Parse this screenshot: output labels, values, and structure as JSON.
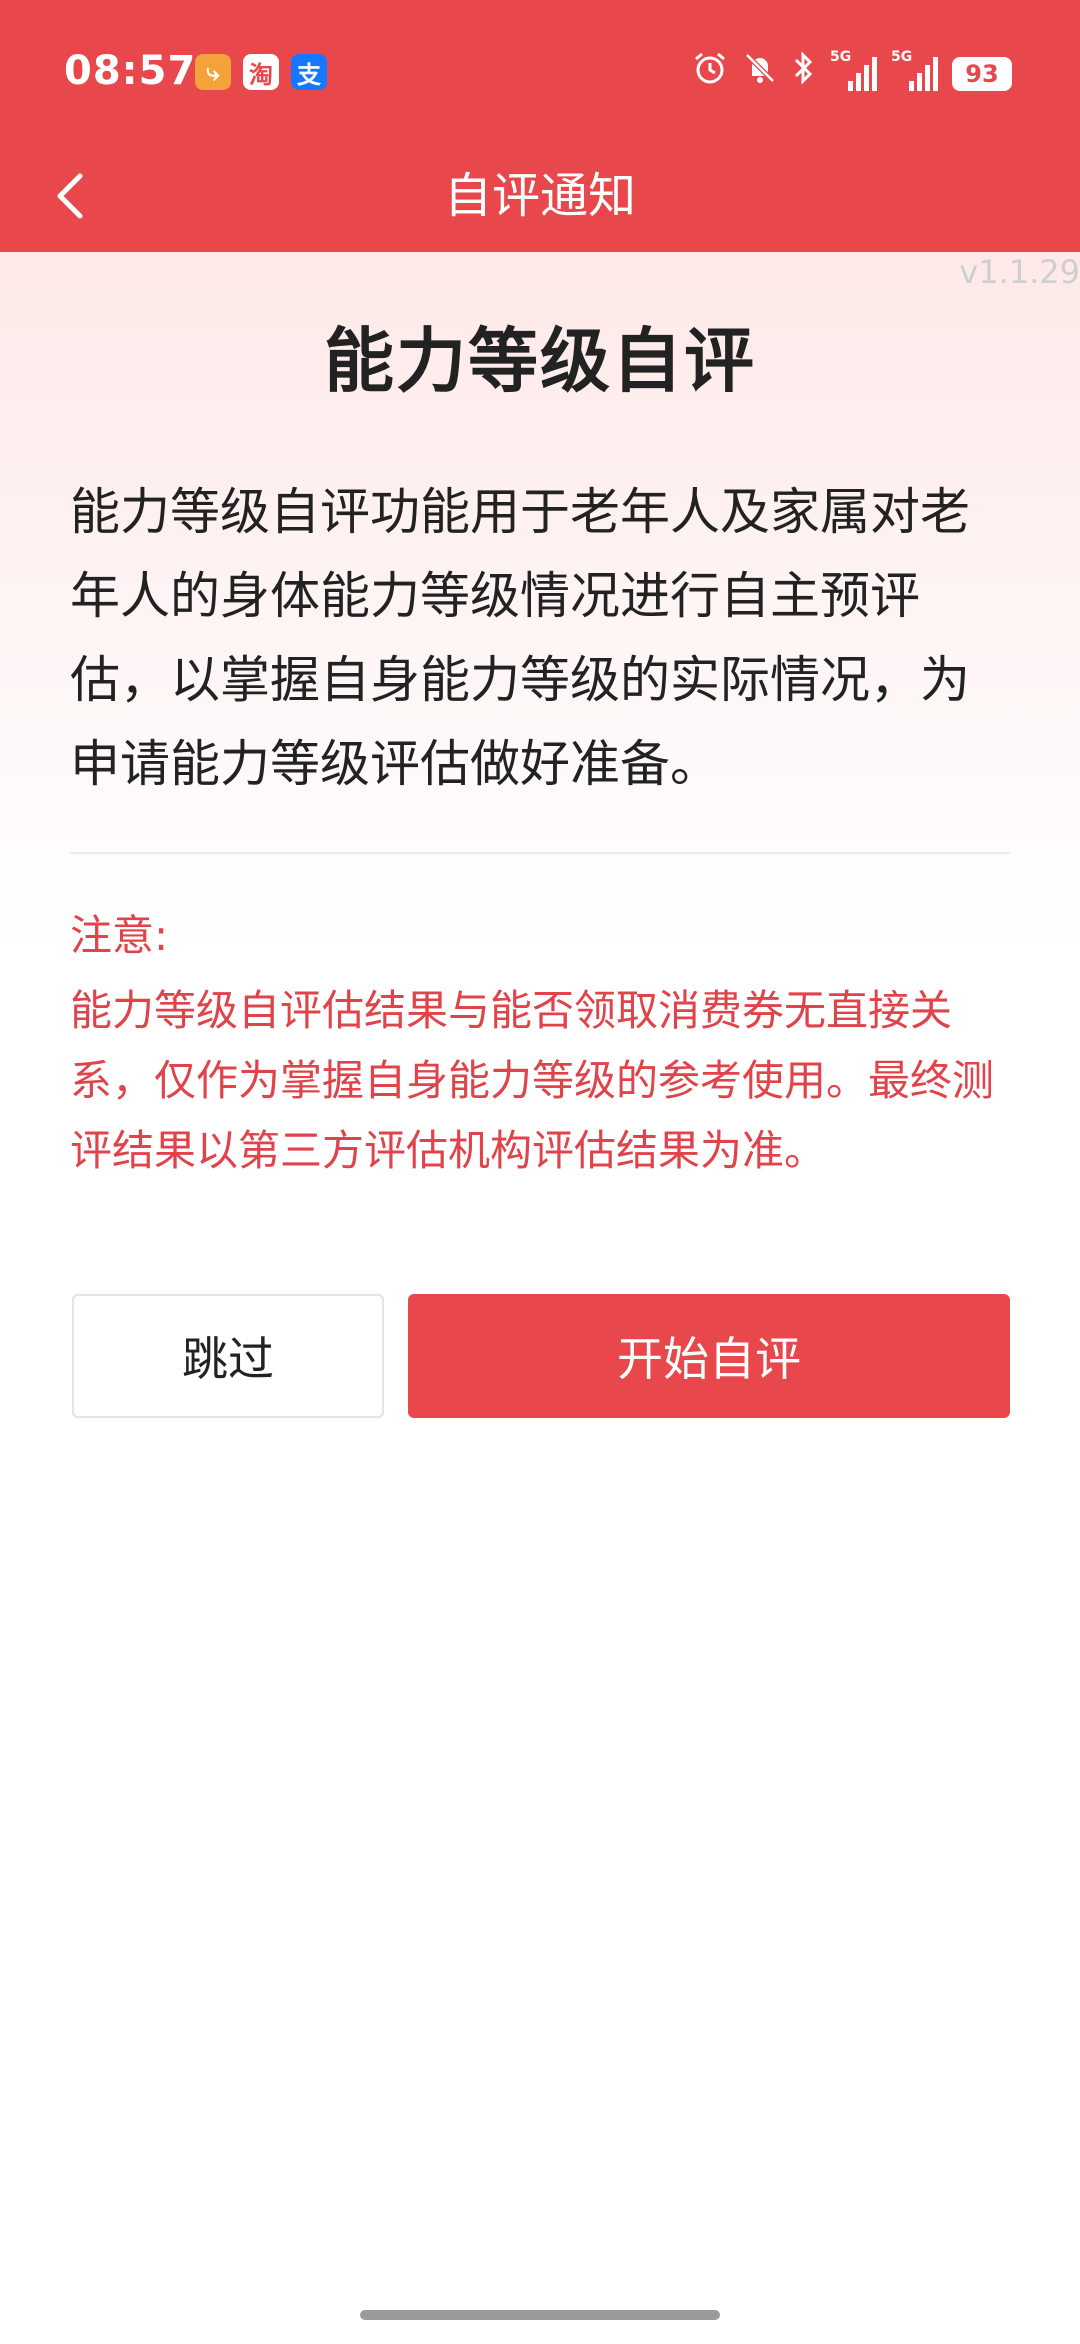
{
  "status_bar": {
    "time": "08:57",
    "app_icons": [
      {
        "name": "app-icon-orange",
        "glyph": "⤷",
        "color": "#f6a23a"
      },
      {
        "name": "taobao-icon",
        "glyph": "淘",
        "color": "#e8474c"
      },
      {
        "name": "alipay-icon",
        "glyph": "支",
        "color": "#1677ff"
      }
    ],
    "network_1": "5G",
    "network_2": "5G",
    "battery": "93"
  },
  "header": {
    "title": "自评通知",
    "back_icon": "chevron-left-icon",
    "color": "#e8474c"
  },
  "version": "v1.1.29",
  "main": {
    "title": "能力等级自评",
    "description": "能力等级自评功能用于老年人及家属对老年人的身体能力等级情况进行自主预评估，以掌握自身能力等级的实际情况，为申请能力等级评估做好准备。",
    "notice_label": "注意:",
    "notice_text": "能力等级自评估结果与能否领取消费券无直接关系，仅作为掌握自身能力等级的参考使用。最终测评结果以第三方评估机构评估结果为准。"
  },
  "buttons": {
    "skip": "跳过",
    "start": "开始自评"
  }
}
